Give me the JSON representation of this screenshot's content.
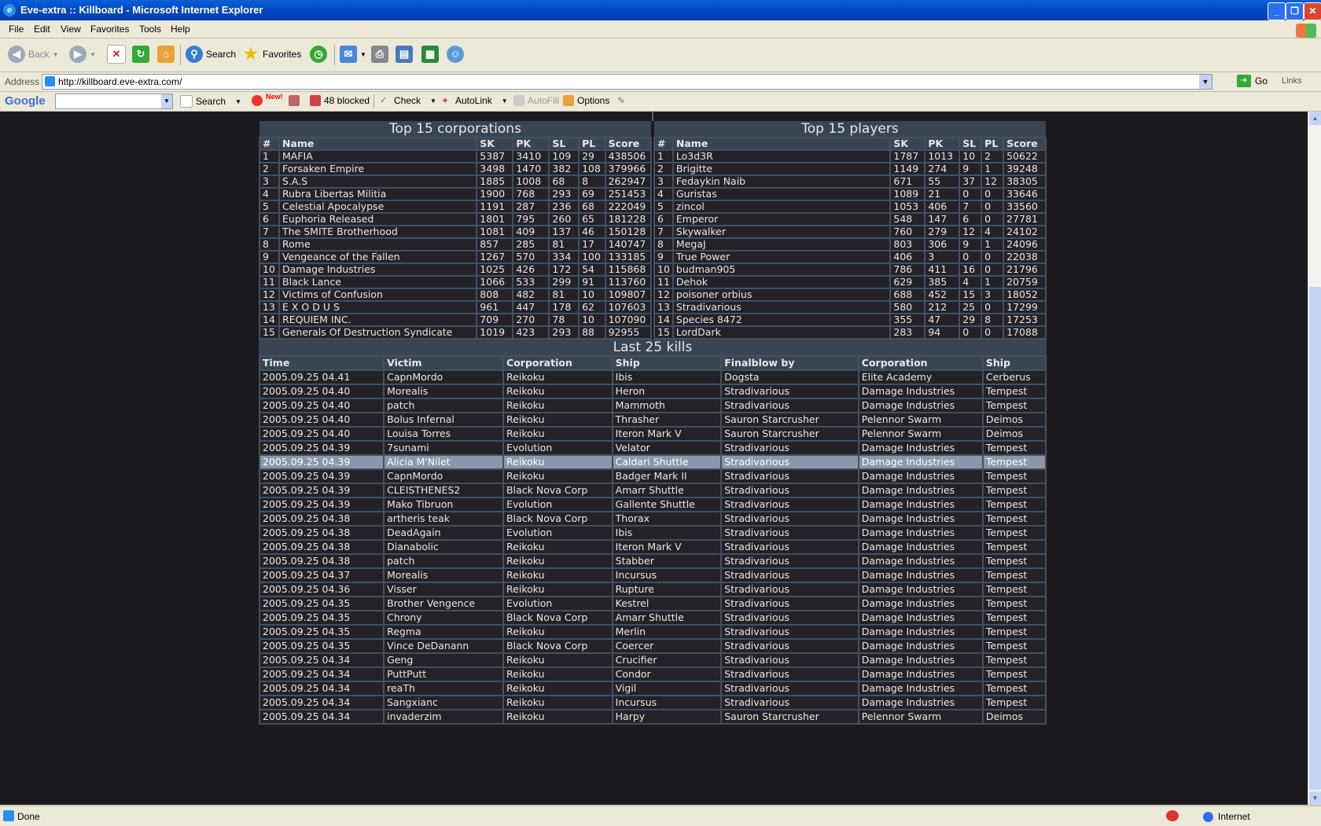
{
  "window": {
    "title": "Eve-extra :: Killboard - Microsoft Internet Explorer"
  },
  "menu": [
    "File",
    "Edit",
    "View",
    "Favorites",
    "Tools",
    "Help"
  ],
  "toolbar": {
    "back": "Back",
    "search": "Search",
    "favorites": "Favorites"
  },
  "address": {
    "label": "Address",
    "url": "http://killboard.eve-extra.com/",
    "go": "Go",
    "links": "Links"
  },
  "googlebar": {
    "logo": "Google",
    "search": "Search",
    "new_badge": "New!",
    "blocked": "48 blocked",
    "check": "Check",
    "autolink": "AutoLink",
    "autofill": "AutoFill",
    "options": "Options"
  },
  "status": {
    "text": "Done",
    "zone": "Internet"
  },
  "corporations": {
    "title": "Top 15 corporations",
    "headers": [
      "#",
      "Name",
      "SK",
      "PK",
      "SL",
      "PL",
      "Score"
    ],
    "rows": [
      [
        "1",
        "MAFIA",
        "5387",
        "3410",
        "109",
        "29",
        "438506"
      ],
      [
        "2",
        "Forsaken Empire",
        "3498",
        "1470",
        "382",
        "108",
        "379966"
      ],
      [
        "3",
        "S.A.S",
        "1885",
        "1008",
        "68",
        "8",
        "262947"
      ],
      [
        "4",
        "Rubra Libertas Militia",
        "1900",
        "768",
        "293",
        "69",
        "251453"
      ],
      [
        "5",
        "Celestial Apocalypse",
        "1191",
        "287",
        "236",
        "68",
        "222049"
      ],
      [
        "6",
        "Euphoria Released",
        "1801",
        "795",
        "260",
        "65",
        "181228"
      ],
      [
        "7",
        "The SMITE Brotherhood",
        "1081",
        "409",
        "137",
        "46",
        "150128"
      ],
      [
        "8",
        "Rome",
        "857",
        "285",
        "81",
        "17",
        "140747"
      ],
      [
        "9",
        "Vengeance of the Fallen",
        "1267",
        "570",
        "334",
        "100",
        "133185"
      ],
      [
        "10",
        "Damage Industries",
        "1025",
        "426",
        "172",
        "54",
        "115868"
      ],
      [
        "11",
        "Black Lance",
        "1066",
        "533",
        "299",
        "91",
        "113760"
      ],
      [
        "12",
        "Victims of Confusion",
        "808",
        "482",
        "81",
        "10",
        "109807"
      ],
      [
        "13",
        "E X O D U S",
        "961",
        "447",
        "178",
        "62",
        "107603"
      ],
      [
        "14",
        "REQUIEM INC.",
        "709",
        "270",
        "78",
        "10",
        "107090"
      ],
      [
        "15",
        "Generals Of Destruction Syndicate",
        "1019",
        "423",
        "293",
        "88",
        "92955"
      ]
    ]
  },
  "players": {
    "title": "Top 15 players",
    "headers": [
      "#",
      "Name",
      "SK",
      "PK",
      "SL",
      "PL",
      "Score"
    ],
    "rows": [
      [
        "1",
        "Lo3d3R",
        "1787",
        "1013",
        "10",
        "2",
        "50622"
      ],
      [
        "2",
        "Brigitte",
        "1149",
        "274",
        "9",
        "1",
        "39248"
      ],
      [
        "3",
        "Fedaykin Naib",
        "671",
        "55",
        "37",
        "12",
        "38305"
      ],
      [
        "4",
        "Guristas",
        "1089",
        "21",
        "0",
        "0",
        "33646"
      ],
      [
        "5",
        "zincol",
        "1053",
        "406",
        "7",
        "0",
        "33560"
      ],
      [
        "6",
        "Emperor",
        "548",
        "147",
        "6",
        "0",
        "27781"
      ],
      [
        "7",
        "Skywalker",
        "760",
        "279",
        "12",
        "4",
        "24102"
      ],
      [
        "8",
        "MegaJ",
        "803",
        "306",
        "9",
        "1",
        "24096"
      ],
      [
        "9",
        "True Power",
        "406",
        "3",
        "0",
        "0",
        "22038"
      ],
      [
        "10",
        "budman905",
        "786",
        "411",
        "16",
        "0",
        "21796"
      ],
      [
        "11",
        "Dehok",
        "629",
        "385",
        "4",
        "1",
        "20759"
      ],
      [
        "12",
        "poisoner orbius",
        "688",
        "452",
        "15",
        "3",
        "18052"
      ],
      [
        "13",
        "Stradivarious",
        "580",
        "212",
        "25",
        "0",
        "17299"
      ],
      [
        "14",
        "Species 8472",
        "355",
        "47",
        "29",
        "8",
        "17253"
      ],
      [
        "15",
        "LordDark",
        "283",
        "94",
        "0",
        "0",
        "17088"
      ]
    ]
  },
  "kills": {
    "title": "Last 25 kills",
    "headers": [
      "Time",
      "Victim",
      "Corporation",
      "Ship",
      "Finalblow by",
      "Corporation",
      "Ship"
    ],
    "highlight_row": 6,
    "rows": [
      [
        "2005.09.25 04.41",
        "CapnMordo",
        "Reikoku",
        "Ibis",
        "Dogsta",
        "Elite Academy",
        "Cerberus"
      ],
      [
        "2005.09.25 04.40",
        "Morealis",
        "Reikoku",
        "Heron",
        "Stradivarious",
        "Damage Industries",
        "Tempest"
      ],
      [
        "2005.09.25 04.40",
        "patch",
        "Reikoku",
        "Mammoth",
        "Stradivarious",
        "Damage Industries",
        "Tempest"
      ],
      [
        "2005.09.25 04.40",
        "Bolus Infernal",
        "Reikoku",
        "Thrasher",
        "Sauron Starcrusher",
        "Pelennor Swarm",
        "Deimos"
      ],
      [
        "2005.09.25 04.40",
        "Louisa Torres",
        "Reikoku",
        "Iteron Mark V",
        "Sauron Starcrusher",
        "Pelennor Swarm",
        "Deimos"
      ],
      [
        "2005.09.25 04.39",
        "7sunami",
        "Evolution",
        "Velator",
        "Stradivarious",
        "Damage Industries",
        "Tempest"
      ],
      [
        "2005.09.25 04.39",
        "Alicia M'Nilet",
        "Reikoku",
        "Caldari Shuttle",
        "Stradivarious",
        "Damage Industries",
        "Tempest"
      ],
      [
        "2005.09.25 04.39",
        "CapnMordo",
        "Reikoku",
        "Badger Mark II",
        "Stradivarious",
        "Damage Industries",
        "Tempest"
      ],
      [
        "2005.09.25 04.39",
        "CLEISTHENES2",
        "Black Nova Corp",
        "Amarr Shuttle",
        "Stradivarious",
        "Damage Industries",
        "Tempest"
      ],
      [
        "2005.09.25 04.39",
        "Mako Tibruon",
        "Evolution",
        "Gallente Shuttle",
        "Stradivarious",
        "Damage Industries",
        "Tempest"
      ],
      [
        "2005.09.25 04.38",
        "artheris teak",
        "Black Nova Corp",
        "Thorax",
        "Stradivarious",
        "Damage Industries",
        "Tempest"
      ],
      [
        "2005.09.25 04.38",
        "DeadAgain",
        "Evolution",
        "Ibis",
        "Stradivarious",
        "Damage Industries",
        "Tempest"
      ],
      [
        "2005.09.25 04.38",
        "Dianabolic",
        "Reikoku",
        "Iteron Mark V",
        "Stradivarious",
        "Damage Industries",
        "Tempest"
      ],
      [
        "2005.09.25 04.38",
        "patch",
        "Reikoku",
        "Stabber",
        "Stradivarious",
        "Damage Industries",
        "Tempest"
      ],
      [
        "2005.09.25 04.37",
        "Morealis",
        "Reikoku",
        "Incursus",
        "Stradivarious",
        "Damage Industries",
        "Tempest"
      ],
      [
        "2005.09.25 04.36",
        "Visser",
        "Reikoku",
        "Rupture",
        "Stradivarious",
        "Damage Industries",
        "Tempest"
      ],
      [
        "2005.09.25 04.35",
        "Brother Vengence",
        "Evolution",
        "Kestrel",
        "Stradivarious",
        "Damage Industries",
        "Tempest"
      ],
      [
        "2005.09.25 04.35",
        "Chrony",
        "Black Nova Corp",
        "Amarr Shuttle",
        "Stradivarious",
        "Damage Industries",
        "Tempest"
      ],
      [
        "2005.09.25 04.35",
        "Regma",
        "Reikoku",
        "Merlin",
        "Stradivarious",
        "Damage Industries",
        "Tempest"
      ],
      [
        "2005.09.25 04.35",
        "Vince DeDanann",
        "Black Nova Corp",
        "Coercer",
        "Stradivarious",
        "Damage Industries",
        "Tempest"
      ],
      [
        "2005.09.25 04.34",
        "Geng",
        "Reikoku",
        "Crucifier",
        "Stradivarious",
        "Damage Industries",
        "Tempest"
      ],
      [
        "2005.09.25 04.34",
        "PuttPutt",
        "Reikoku",
        "Condor",
        "Stradivarious",
        "Damage Industries",
        "Tempest"
      ],
      [
        "2005.09.25 04.34",
        "reaTh",
        "Reikoku",
        "Vigil",
        "Stradivarious",
        "Damage Industries",
        "Tempest"
      ],
      [
        "2005.09.25 04.34",
        "Sangxianc",
        "Reikoku",
        "Incursus",
        "Stradivarious",
        "Damage Industries",
        "Tempest"
      ],
      [
        "2005.09.25 04.34",
        "invaderzim",
        "Reikoku",
        "Harpy",
        "Sauron Starcrusher",
        "Pelennor Swarm",
        "Deimos"
      ]
    ]
  }
}
